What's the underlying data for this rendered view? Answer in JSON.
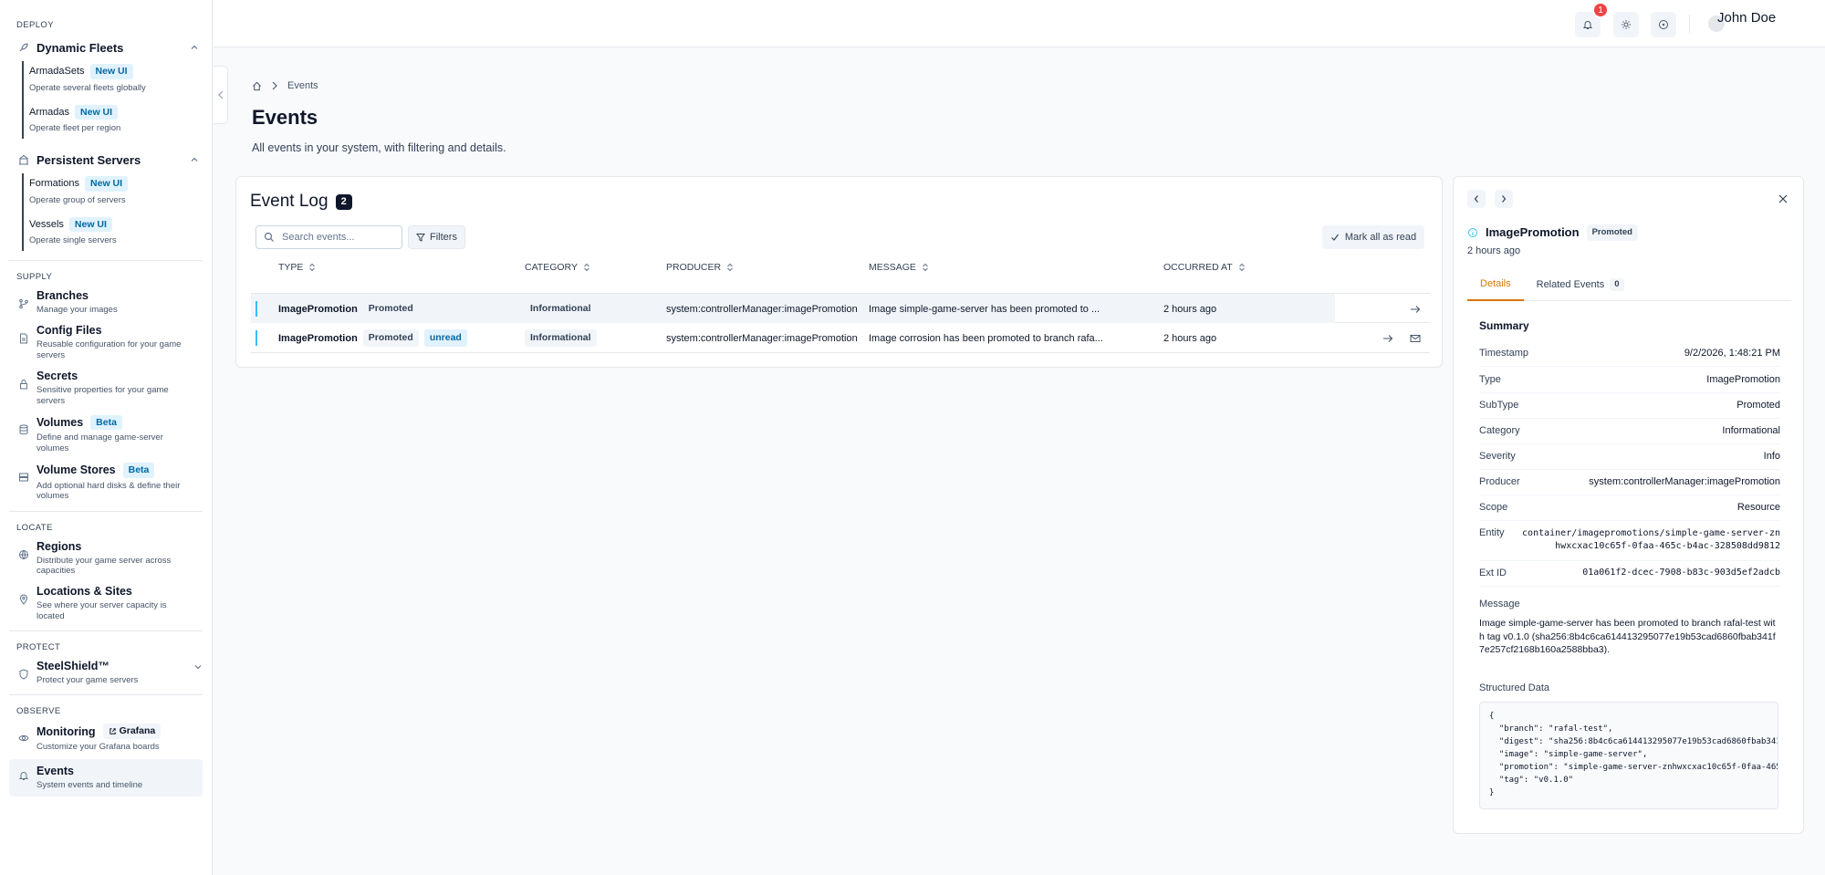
{
  "sidebar": {
    "deploy": {
      "heading": "DEPLOY",
      "dynamic_fleets": {
        "label": "Dynamic Fleets",
        "items": [
          {
            "name": "ArmadaSets",
            "badge": "New UI",
            "desc": "Operate several fleets globally"
          },
          {
            "name": "Armadas",
            "badge": "New UI",
            "desc": "Operate fleet per region"
          }
        ]
      },
      "persistent_servers": {
        "label": "Persistent Servers",
        "items": [
          {
            "name": "Formations",
            "badge": "New UI",
            "desc": "Operate group of servers"
          },
          {
            "name": "Vessels",
            "badge": "New UI",
            "desc": "Operate single servers"
          }
        ]
      }
    },
    "supply": {
      "heading": "SUPPLY",
      "items": [
        {
          "name": "Branches",
          "desc": "Manage your images"
        },
        {
          "name": "Config Files",
          "desc": "Reusable configuration for your game servers"
        },
        {
          "name": "Secrets",
          "desc": "Sensitive properties for your game servers"
        },
        {
          "name": "Volumes",
          "badge": "Beta",
          "desc": "Define and manage game-server volumes"
        },
        {
          "name": "Volume Stores",
          "badge": "Beta",
          "desc": "Add optional hard disks & define their volumes"
        }
      ]
    },
    "locate": {
      "heading": "LOCATE",
      "items": [
        {
          "name": "Regions",
          "desc": "Distribute your game server across capacities"
        },
        {
          "name": "Locations & Sites",
          "desc": "See where your server capacity is located"
        }
      ]
    },
    "protect": {
      "heading": "PROTECT",
      "items": [
        {
          "name": "SteelShield™",
          "desc": "Protect your game servers"
        }
      ]
    },
    "observe": {
      "heading": "OBSERVE",
      "items": [
        {
          "name": "Monitoring",
          "badge": "Grafana",
          "desc": "Customize your Grafana boards"
        },
        {
          "name": "Events",
          "desc": "System events and timeline"
        }
      ]
    }
  },
  "topbar": {
    "notifications": "1",
    "user": "John Doe"
  },
  "breadcrumb": {
    "current": "Events"
  },
  "page": {
    "title": "Events",
    "subtitle": "All events in your system, with filtering and details."
  },
  "event_log": {
    "title": "Event Log",
    "count": "2",
    "search_placeholder": "Search events...",
    "filters_label": "Filters",
    "mark_read_label": "Mark all as read",
    "columns": [
      "TYPE",
      "CATEGORY",
      "PRODUCER",
      "MESSAGE",
      "OCCURRED AT"
    ],
    "rows": [
      {
        "type": "ImagePromotion",
        "subtype": "Promoted",
        "unread": "",
        "category": "Informational",
        "producer": "system:controllerManager:imagePromotion",
        "message": "Image simple-game-server has been promoted to ...",
        "occurred": "2 hours ago"
      },
      {
        "type": "ImagePromotion",
        "subtype": "Promoted",
        "unread": "unread",
        "category": "Informational",
        "producer": "system:controllerManager:imagePromotion",
        "message": "Image corrosion has been promoted to branch rafa...",
        "occurred": "2 hours ago"
      }
    ]
  },
  "detail": {
    "title": "ImagePromotion",
    "badge": "Promoted",
    "time": "2 hours ago",
    "tabs": {
      "details": "Details",
      "related": "Related Events",
      "related_count": "0"
    },
    "summary_heading": "Summary",
    "fields": [
      {
        "k": "Timestamp",
        "v": "9/2/2026, 1:48:21 PM"
      },
      {
        "k": "Type",
        "v": "ImagePromotion"
      },
      {
        "k": "SubType",
        "v": "Promoted"
      },
      {
        "k": "Category",
        "v": "Informational"
      },
      {
        "k": "Severity",
        "v": "Info"
      },
      {
        "k": "Producer",
        "v": "system:controllerManager:imagePromotion"
      },
      {
        "k": "Scope",
        "v": "Resource"
      },
      {
        "k": "Entity",
        "v": "container/imagepromotions/simple-game-server-znhwxcxac10c65f-0faa-465c-b4ac-328508dd9812"
      },
      {
        "k": "Ext ID",
        "v": "01a061f2-dcec-7908-b83c-903d5ef2adcb"
      }
    ],
    "message_label": "Message",
    "message": "Image simple-game-server has been promoted to branch rafal-test with tag v0.1.0 (sha256:8b4c6ca614413295077e19b53cad6860fbab341f7e257cf2168b160a2588bba3).",
    "structured_label": "Structured Data",
    "structured": "{\n  \"branch\": \"rafal-test\",\n  \"digest\": \"sha256:8b4c6ca614413295077e19b53cad6860fbab341\n  \"image\": \"simple-game-server\",\n  \"promotion\": \"simple-game-server-znhwxcxac10c65f-0faa-465-\n  \"tag\": \"v0.1.0\"\n}"
  }
}
